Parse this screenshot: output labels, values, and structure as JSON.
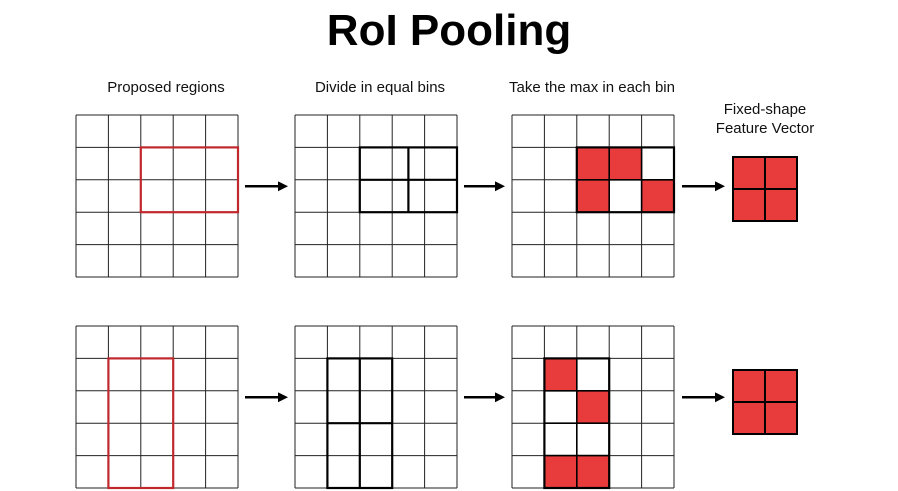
{
  "title": "RoI Pooling",
  "captions": {
    "proposed": "Proposed regions",
    "divide": "Divide in equal bins",
    "max": "Take the max in each bin",
    "fixed_line1": "Fixed-shape",
    "fixed_line2": "Feature Vector"
  },
  "colors": {
    "grid": "#222222",
    "region": "#c0282d",
    "fill": "#e83c3c",
    "arrow": "#000000"
  },
  "grid_size": [
    5,
    5
  ],
  "output_shape": [
    2,
    2
  ],
  "rows": [
    {
      "region": {
        "col": 2,
        "row": 1,
        "cols": 3,
        "rows": 2
      },
      "bins": {
        "cols": 2,
        "rows": 2
      },
      "max_cells": [
        [
          2,
          1
        ],
        [
          3,
          1
        ],
        [
          2,
          2
        ],
        [
          4,
          2
        ]
      ]
    },
    {
      "region": {
        "col": 1,
        "row": 1,
        "cols": 2,
        "rows": 4
      },
      "bins": {
        "cols": 2,
        "rows": 2
      },
      "max_cells": [
        [
          1,
          1
        ],
        [
          2,
          2
        ],
        [
          1,
          4
        ],
        [
          2,
          4
        ]
      ]
    }
  ]
}
